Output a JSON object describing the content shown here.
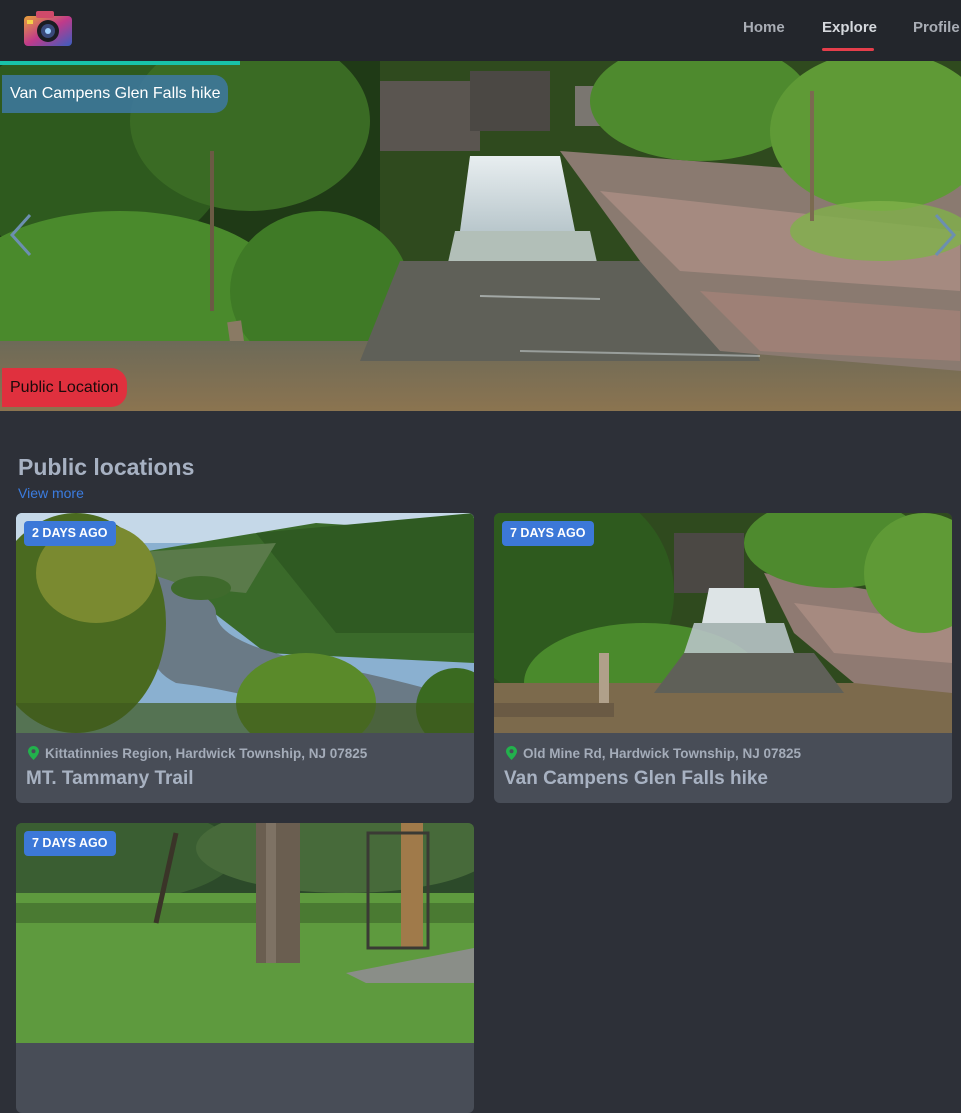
{
  "header": {
    "logo_icon": "camera-logo-icon",
    "nav": [
      {
        "label": "Home",
        "active": false
      },
      {
        "label": "Explore",
        "active": true
      },
      {
        "label": "Profile",
        "active": false
      }
    ],
    "accent_color": "#e53e4b"
  },
  "hero": {
    "title": "Van Campens Glen Falls hike",
    "badge": "Public Location",
    "prev_icon": "chevron-left-icon",
    "next_icon": "chevron-right-icon",
    "image": "waterfall-photo",
    "progress_color": "#19c2a8"
  },
  "section": {
    "title": "Public locations",
    "view_more": "View more"
  },
  "cards": [
    {
      "age": "2 DAYS AGO",
      "location": "Kittatinnies Region, Hardwick Township, NJ 07825",
      "title": "MT. Tammany Trail",
      "image": "river-valley-photo"
    },
    {
      "age": "7 DAYS AGO",
      "location": "Old Mine Rd, Hardwick Township, NJ 07825",
      "title": "Van Campens Glen Falls hike",
      "image": "waterfall-photo"
    },
    {
      "age": "7 DAYS AGO",
      "location": "",
      "title": "",
      "image": "park-field-photo"
    }
  ],
  "colors": {
    "badge_blue": "#3c78d8",
    "pin_green": "#22b14c",
    "public_red": "#e0303e"
  }
}
